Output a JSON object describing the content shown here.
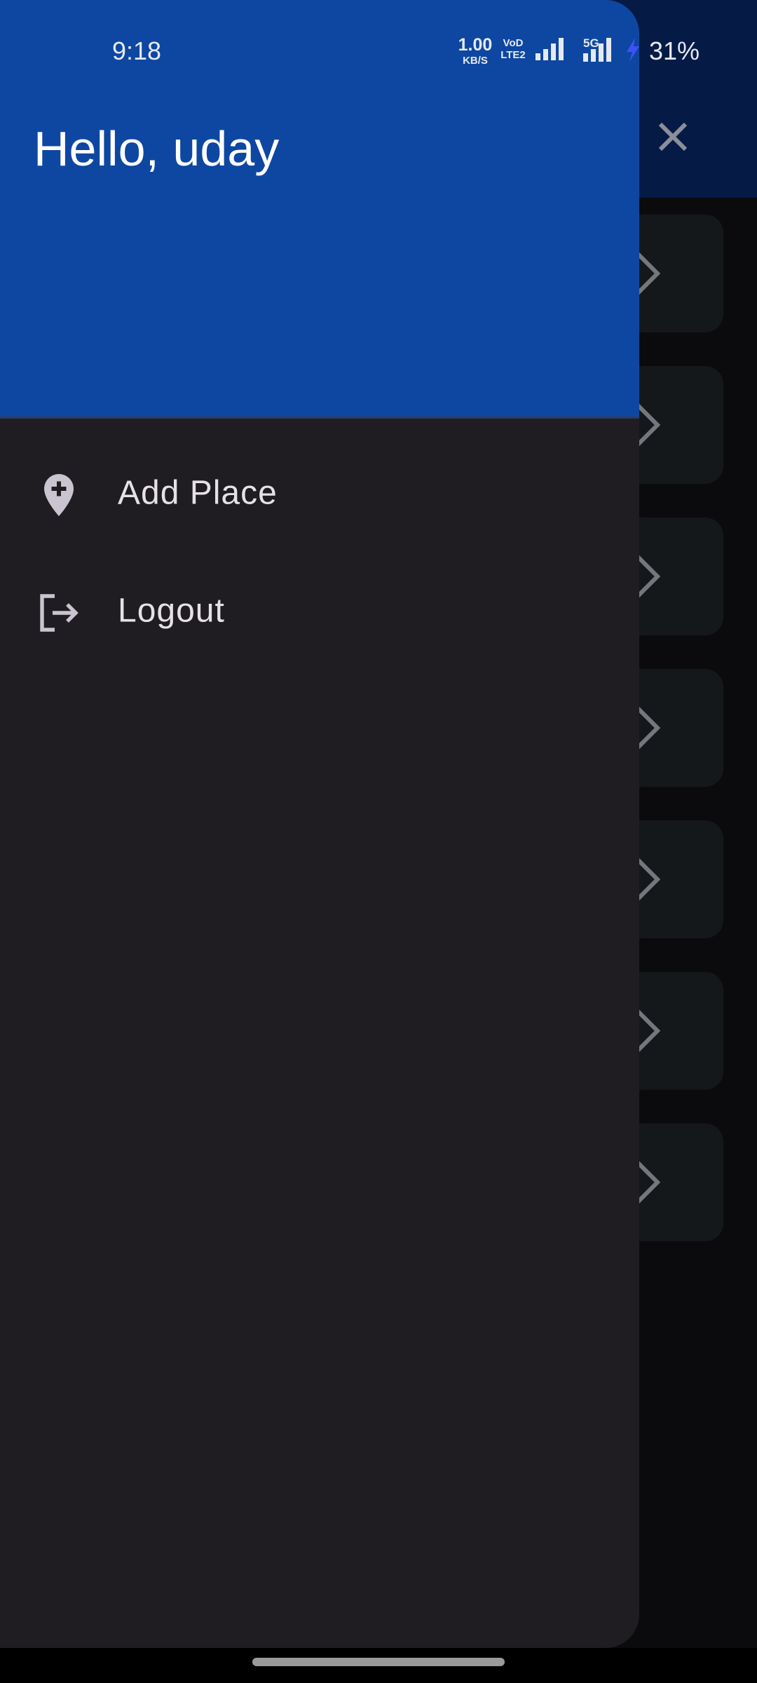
{
  "status_bar": {
    "time": "9:18",
    "net_speed_value": "1.00",
    "net_speed_unit": "KB/S",
    "volte_top": "VoD",
    "volte_bottom": "LTE2",
    "network_label": "5G",
    "battery": "31%"
  },
  "drawer": {
    "greeting": "Hello, uday",
    "items": [
      {
        "label": "Add Place",
        "icon": "add-location-icon"
      },
      {
        "label": "Logout",
        "icon": "logout-icon"
      }
    ]
  },
  "background_app": {
    "close_icon": "close-icon",
    "card_count": 7
  },
  "colors": {
    "drawer_header": "#0d47a1",
    "drawer_body": "#1f1d21",
    "text_primary": "#e6e1e5"
  }
}
